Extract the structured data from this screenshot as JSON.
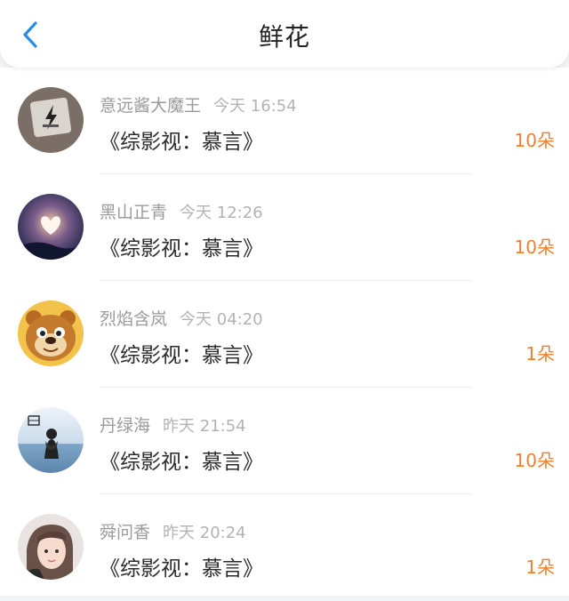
{
  "header": {
    "title": "鲜花",
    "back_icon": "chevron-left-icon"
  },
  "colors": {
    "accent_blue": "#2b8ce5",
    "count_orange": "#f0802b"
  },
  "records": [
    {
      "user": "意远酱大魔王",
      "time": "今天 16:54",
      "book": "《综影视：慕言》",
      "count": "10朵",
      "avatar": "avatar-icon"
    },
    {
      "user": "黑山正青",
      "time": "今天 12:26",
      "book": "《综影视：慕言》",
      "count": "10朵",
      "avatar": "avatar-icon"
    },
    {
      "user": "烈焰含岚",
      "time": "今天 04:20",
      "book": "《综影视：慕言》",
      "count": "1朵",
      "avatar": "avatar-icon"
    },
    {
      "user": "丹绿海",
      "time": "昨天 21:54",
      "book": "《综影视：慕言》",
      "count": "10朵",
      "avatar": "avatar-icon"
    },
    {
      "user": "舜问香",
      "time": "昨天 20:24",
      "book": "《综影视：慕言》",
      "count": "1朵",
      "avatar": "avatar-icon"
    }
  ]
}
